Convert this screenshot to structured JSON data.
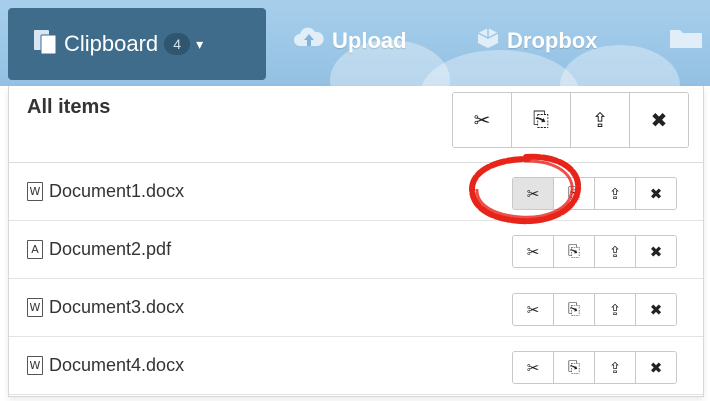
{
  "toolbar": {
    "clipboard": {
      "label": "Clipboard",
      "count": "4",
      "caret": "▾",
      "icon": "clipboard-icon"
    },
    "upload": {
      "label": "Upload",
      "icon": "cloud-upload-icon"
    },
    "dropbox": {
      "label": "Dropbox",
      "icon": "dropbox-icon"
    }
  },
  "panel": {
    "title": "All items",
    "actions": {
      "cut": "✂",
      "copy": "⎘",
      "open": "⇪",
      "remove": "✖"
    },
    "items": [
      {
        "name": "Document1.docx",
        "type_glyph": "W",
        "icon": "word-file-icon"
      },
      {
        "name": "Document2.pdf",
        "type_glyph": "A",
        "icon": "pdf-file-icon"
      },
      {
        "name": "Document3.docx",
        "type_glyph": "W",
        "icon": "word-file-icon"
      },
      {
        "name": "Document4.docx",
        "type_glyph": "W",
        "icon": "word-file-icon"
      }
    ]
  },
  "colors": {
    "toolbar_bg": "#9cc6e7",
    "active_tab": "#3f6c8a",
    "highlight": "#e8241a"
  }
}
